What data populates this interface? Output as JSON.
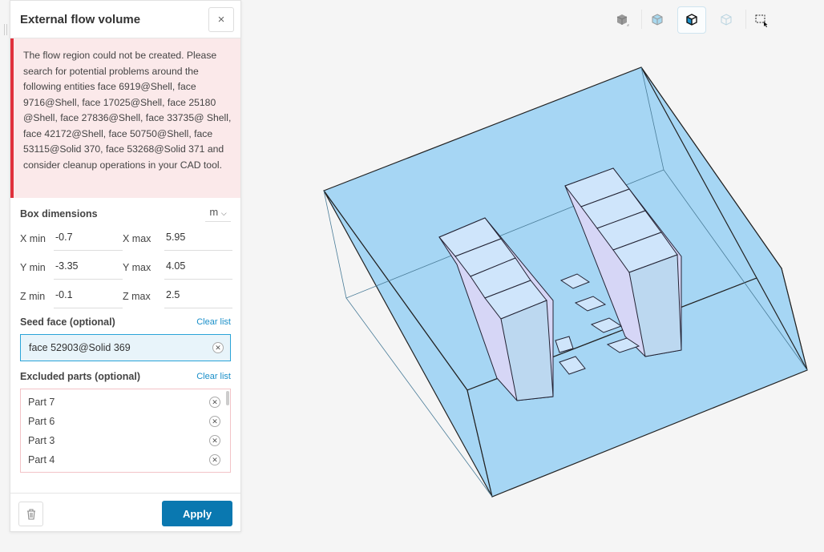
{
  "panel": {
    "title": "External flow volume",
    "close_label": "×",
    "error": "The flow region could not be created. Please search for potential problems around the following entities face 6919@Shell, face 9716@Shell, face 17025@Shell, face 25180 @Shell, face 27836@Shell, face 33735@ Shell, face 42172@Shell, face 50750@Shell, face 53115@Solid 370, face 53268@Solid 371 and consider cleanup operations in your CAD tool.",
    "box_label": "Box dimensions",
    "unit": "m",
    "unit_chevron": "⌵",
    "dims": [
      {
        "k": "X min",
        "v": "-0.7"
      },
      {
        "k": "X max",
        "v": "5.95"
      },
      {
        "k": "Y min",
        "v": "-3.35"
      },
      {
        "k": "Y max",
        "v": "4.05"
      },
      {
        "k": "Z min",
        "v": "-0.1"
      },
      {
        "k": "Z max",
        "v": "2.5"
      }
    ],
    "seed_label": "Seed face (optional)",
    "seed_clear": "Clear list",
    "seed_value": "face 52903@Solid 369",
    "excluded_label": "Excluded parts (optional)",
    "excluded_clear": "Clear list",
    "excluded": [
      "Part 7",
      "Part 6",
      "Part 3",
      "Part 4"
    ],
    "apply": "Apply"
  },
  "toolbar": {
    "icons": [
      "solid-view-icon",
      "transparent-view-icon",
      "edges-view-icon",
      "wireframe-view-icon",
      "box-select-icon"
    ],
    "active": 2,
    "accent": "#1a8fc9"
  }
}
